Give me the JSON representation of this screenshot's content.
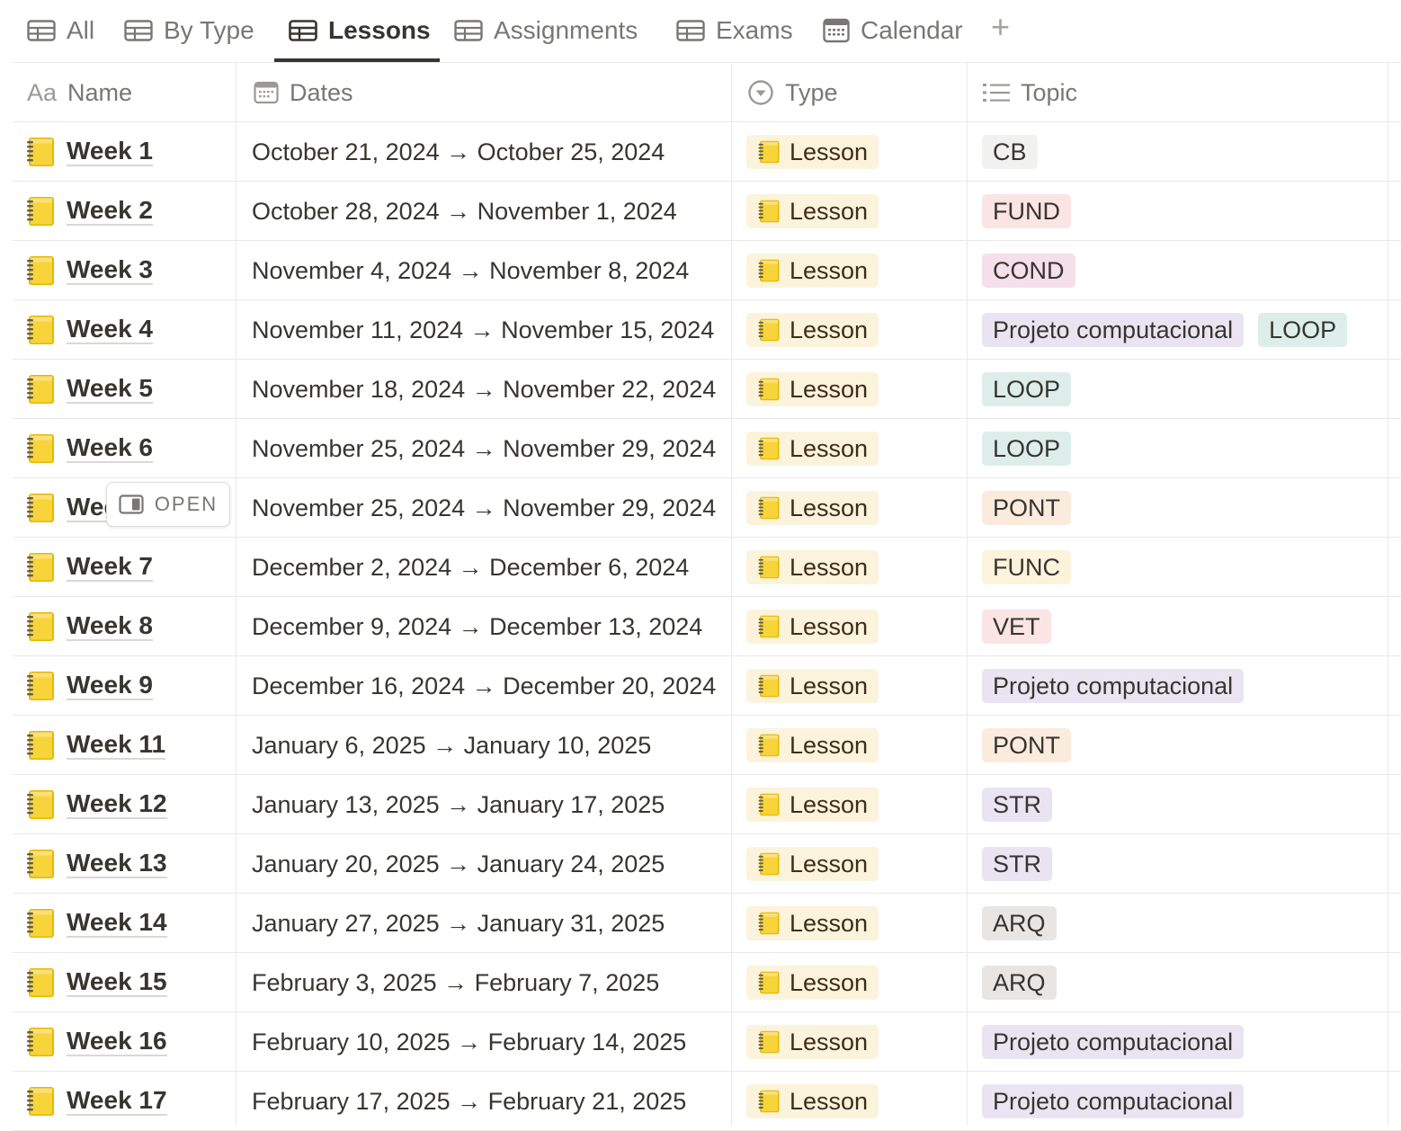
{
  "tabs": [
    {
      "label": "All",
      "icon": "table-icon",
      "active": false
    },
    {
      "label": "By Type",
      "icon": "table-icon",
      "active": false
    },
    {
      "label": "Lessons",
      "icon": "table-icon",
      "active": true
    },
    {
      "label": "Assignments",
      "icon": "table-icon",
      "active": false
    },
    {
      "label": "Exams",
      "icon": "table-icon",
      "active": false
    },
    {
      "label": "Calendar",
      "icon": "calendar-icon",
      "active": false
    }
  ],
  "add_tab_label": "+",
  "columns": {
    "name": {
      "label": "Name",
      "icon_text": "Aa"
    },
    "dates": {
      "label": "Dates",
      "icon": "calendar-icon"
    },
    "type": {
      "label": "Type",
      "icon": "select-icon"
    },
    "topic": {
      "label": "Topic",
      "icon": "list-icon"
    }
  },
  "open_button": {
    "label": "OPEN",
    "icon": "side-peek-icon"
  },
  "colors": {
    "lesson_bg": "#fbf3db",
    "topic": {
      "CB": "#f1f1ef",
      "FUND": "#fbe4e4",
      "COND": "#f4dfeb",
      "Projeto computacional": "#eae4f2",
      "LOOP": "#ddedea",
      "PONT": "#faebdd",
      "FUNC": "#fbf3db",
      "VET": "#fbe4e4",
      "STR": "#eae4f2",
      "ARQ": "#e9e5e3"
    }
  },
  "rows": [
    {
      "name": "Week 1",
      "dates": "October 21, 2024 → October 25, 2024",
      "type": "Lesson",
      "topics": [
        "CB"
      ]
    },
    {
      "name": "Week 2",
      "dates": "October 28, 2024 → November 1, 2024",
      "type": "Lesson",
      "topics": [
        "FUND"
      ]
    },
    {
      "name": "Week 3",
      "dates": "November 4, 2024 → November 8, 2024",
      "type": "Lesson",
      "topics": [
        "COND"
      ]
    },
    {
      "name": "Week 4",
      "dates": "November 11, 2024 → November 15, 2024",
      "type": "Lesson",
      "topics": [
        "Projeto computacional",
        "LOOP"
      ]
    },
    {
      "name": "Week 5",
      "dates": "November 18, 2024 → November 22, 2024",
      "type": "Lesson",
      "topics": [
        "LOOP"
      ]
    },
    {
      "name": "Week 6",
      "dates": "November 25, 2024 → November 29, 2024",
      "type": "Lesson",
      "topics": [
        "LOOP"
      ]
    },
    {
      "name": "Week 6",
      "dates": "November 25, 2024 → November 29, 2024",
      "type": "Lesson",
      "topics": [
        "PONT"
      ],
      "hover_open": true
    },
    {
      "name": "Week 7",
      "dates": "December 2, 2024 → December 6, 2024",
      "type": "Lesson",
      "topics": [
        "FUNC"
      ]
    },
    {
      "name": "Week 8",
      "dates": "December 9, 2024 → December 13, 2024",
      "type": "Lesson",
      "topics": [
        "VET"
      ]
    },
    {
      "name": "Week 9",
      "dates": "December 16, 2024 → December 20, 2024",
      "type": "Lesson",
      "topics": [
        "Projeto computacional"
      ]
    },
    {
      "name": "Week 11",
      "dates": "January 6, 2025 → January 10, 2025",
      "type": "Lesson",
      "topics": [
        "PONT"
      ]
    },
    {
      "name": "Week 12",
      "dates": "January 13, 2025 → January 17, 2025",
      "type": "Lesson",
      "topics": [
        "STR"
      ]
    },
    {
      "name": "Week 13",
      "dates": "January 20, 2025 → January 24, 2025",
      "type": "Lesson",
      "topics": [
        "STR"
      ]
    },
    {
      "name": "Week 14",
      "dates": "January 27, 2025 → January 31, 2025",
      "type": "Lesson",
      "topics": [
        "ARQ"
      ]
    },
    {
      "name": "Week 15",
      "dates": "February 3, 2025 → February 7, 2025",
      "type": "Lesson",
      "topics": [
        "ARQ"
      ]
    },
    {
      "name": "Week 16",
      "dates": "February 10, 2025 → February 14, 2025",
      "type": "Lesson",
      "topics": [
        "Projeto computacional"
      ]
    },
    {
      "name": "Week 17",
      "dates": "February 17, 2025 → February 21, 2025",
      "type": "Lesson",
      "topics": [
        "Projeto computacional"
      ]
    }
  ]
}
